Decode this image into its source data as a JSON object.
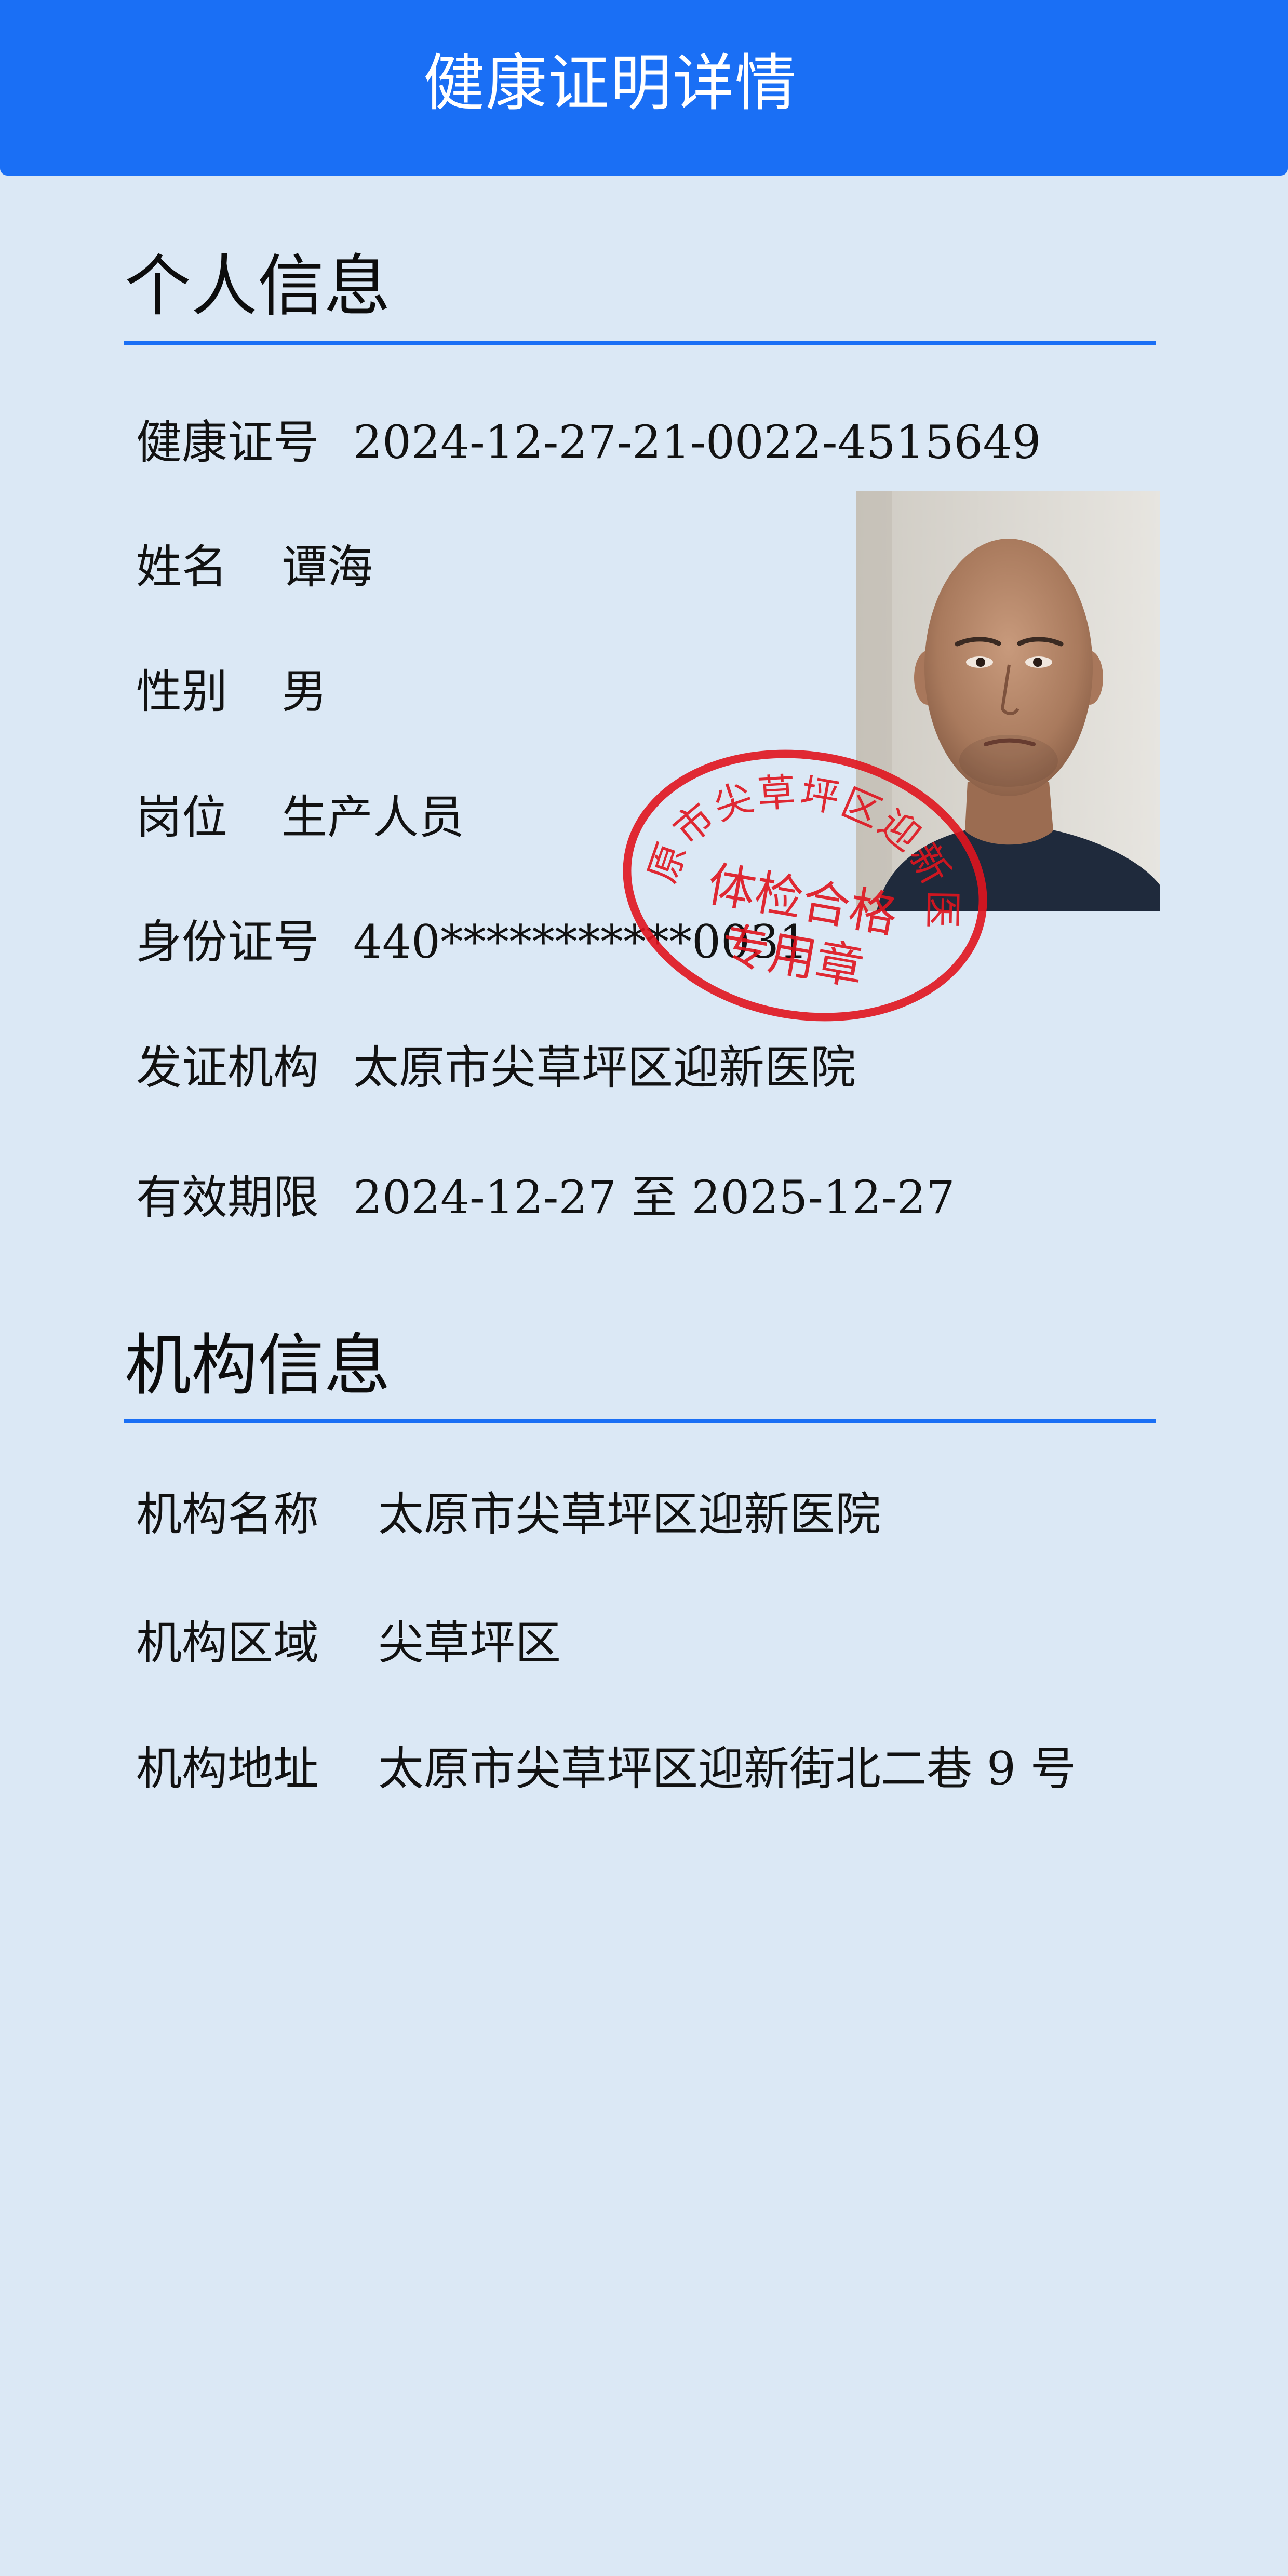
{
  "header": {
    "title": "健康证明详情"
  },
  "personal": {
    "section_title": "个人信息",
    "rows": [
      {
        "label": "健康证号",
        "value": "2024-12-27-21-0022-4515649"
      },
      {
        "label": "姓名",
        "value": "谭海"
      },
      {
        "label": "性别",
        "value": "男"
      },
      {
        "label": "岗位",
        "value": "生产人员"
      },
      {
        "label": "身份证号",
        "value": "440***********0031"
      },
      {
        "label": "发证机构",
        "value": "太原市尖草坪区迎新医院"
      },
      {
        "label": "有效期限",
        "value": "2024-12-27 至 2025-12-27"
      }
    ],
    "photo": "portrait-photo"
  },
  "stamp": {
    "ring_text": "太原市尖草坪区迎新医院",
    "line1": "体检合格",
    "line2": "专用章",
    "color": "#e0141e"
  },
  "institution": {
    "section_title": "机构信息",
    "rows": [
      {
        "label": "机构名称",
        "value": "太原市尖草坪区迎新医院"
      },
      {
        "label": "机构区域",
        "value": "尖草坪区"
      },
      {
        "label": "机构地址",
        "value": "太原市尖草坪区迎新街北二巷 9 号"
      }
    ]
  },
  "colors": {
    "header_bg": "#1a6ff5",
    "page_bg": "#dbe8f5",
    "rule": "#1a6ff5",
    "text": "#111111"
  }
}
